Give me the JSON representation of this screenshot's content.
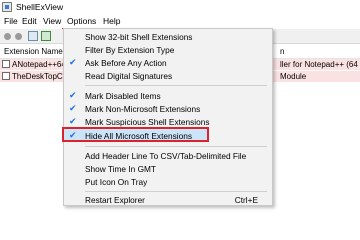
{
  "window": {
    "title": "ShellExView"
  },
  "menu": {
    "file": "File",
    "edit": "Edit",
    "view": "View",
    "options": "Options",
    "help": "Help"
  },
  "list": {
    "headers": {
      "name": "Extension Name",
      "right": "n"
    },
    "rows": [
      {
        "name": "ANotepad++64",
        "right": "ller for Notepad++ (64 ..."
      },
      {
        "name": "TheDeskTopCor",
        "right": "Module"
      }
    ]
  },
  "options_menu": {
    "items": [
      {
        "label": "Show 32-bit Shell Extensions",
        "checked": false
      },
      {
        "label": "Filter By Extension Type",
        "checked": false
      },
      {
        "label": "Ask Before Any Action",
        "checked": true
      },
      {
        "label": "Read Digital Signatures",
        "checked": false
      },
      {
        "label": "Mark Disabled Items",
        "checked": true
      },
      {
        "label": "Mark Non-Microsoft Extensions",
        "checked": true
      },
      {
        "label": "Mark Suspicious Shell Extensions",
        "checked": true
      },
      {
        "label": "Hide All Microsoft Extensions",
        "checked": true
      },
      {
        "label": "Add Header Line To CSV/Tab-Delimited File",
        "checked": false
      },
      {
        "label": "Show Time In GMT",
        "checked": false
      },
      {
        "label": "Put Icon On Tray",
        "checked": false
      },
      {
        "label": "Restart Explorer",
        "checked": false,
        "shortcut": "Ctrl+E"
      }
    ]
  },
  "colors": {
    "highlight_border": "#d9232d",
    "highlight_fill": "#cce4f7",
    "row_mark": "#fbe2e2",
    "check": "#1a73e8"
  }
}
